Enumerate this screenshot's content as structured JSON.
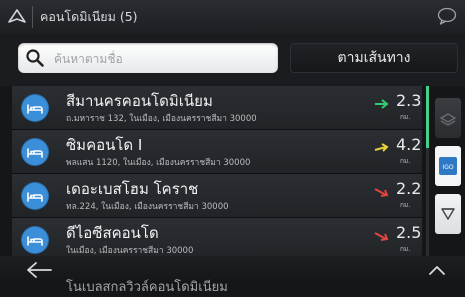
{
  "header": {
    "title": "คอนโดมิเนียม (5)",
    "nav_icon": "navigation-arrow-icon",
    "chat_icon": "chat-bubble-icon"
  },
  "search": {
    "placeholder": "ค้นหาตามชื่อ",
    "value": ""
  },
  "route_button": {
    "label": "ตามเส้นทาง"
  },
  "results": [
    {
      "name": "สีมานครคอนโดมิเนียม",
      "address": "ถ.มหาราช 132, ในเมือง, เมืองนครราชสีมา 30000",
      "distance": "2.3",
      "unit": "กม.",
      "direction_color": "#38c872",
      "icon": "bed-icon"
    },
    {
      "name": "ซิมคอนโด I",
      "address": "พลแสน 1120, ในเมือง, เมืองนครราชสีมา 30000",
      "distance": "4.2",
      "unit": "กม.",
      "direction_color": "#e6d23a",
      "icon": "bed-icon"
    },
    {
      "name": "เดอะเบสโฮม โคราช",
      "address": "ทล.224, ในเมือง, เมืองนครราชสีมา 30000",
      "distance": "2.2",
      "unit": "กม.",
      "direction_color": "#e0443c",
      "icon": "bed-icon"
    },
    {
      "name": "ดีไอซีสคอนโด",
      "address": "ในเมือง, เมืองนครราชสีมา 30000",
      "distance": "2.5",
      "unit": "กม.",
      "direction_color": "#e0443c",
      "icon": "bed-icon"
    }
  ],
  "peek_row": {
    "name": "โนเบลสกลวิวล์คอนโดมิเนียม"
  },
  "side_buttons": {
    "top": "layers-icon",
    "middle": "poi-logo-icon",
    "bottom": "filter-funnel-icon"
  },
  "bottom": {
    "back_icon": "back-arrow-icon",
    "up_icon": "chevron-up-icon"
  },
  "colors": {
    "accent": "#3b8fd9",
    "scroll_thumb": "#46d08a"
  }
}
